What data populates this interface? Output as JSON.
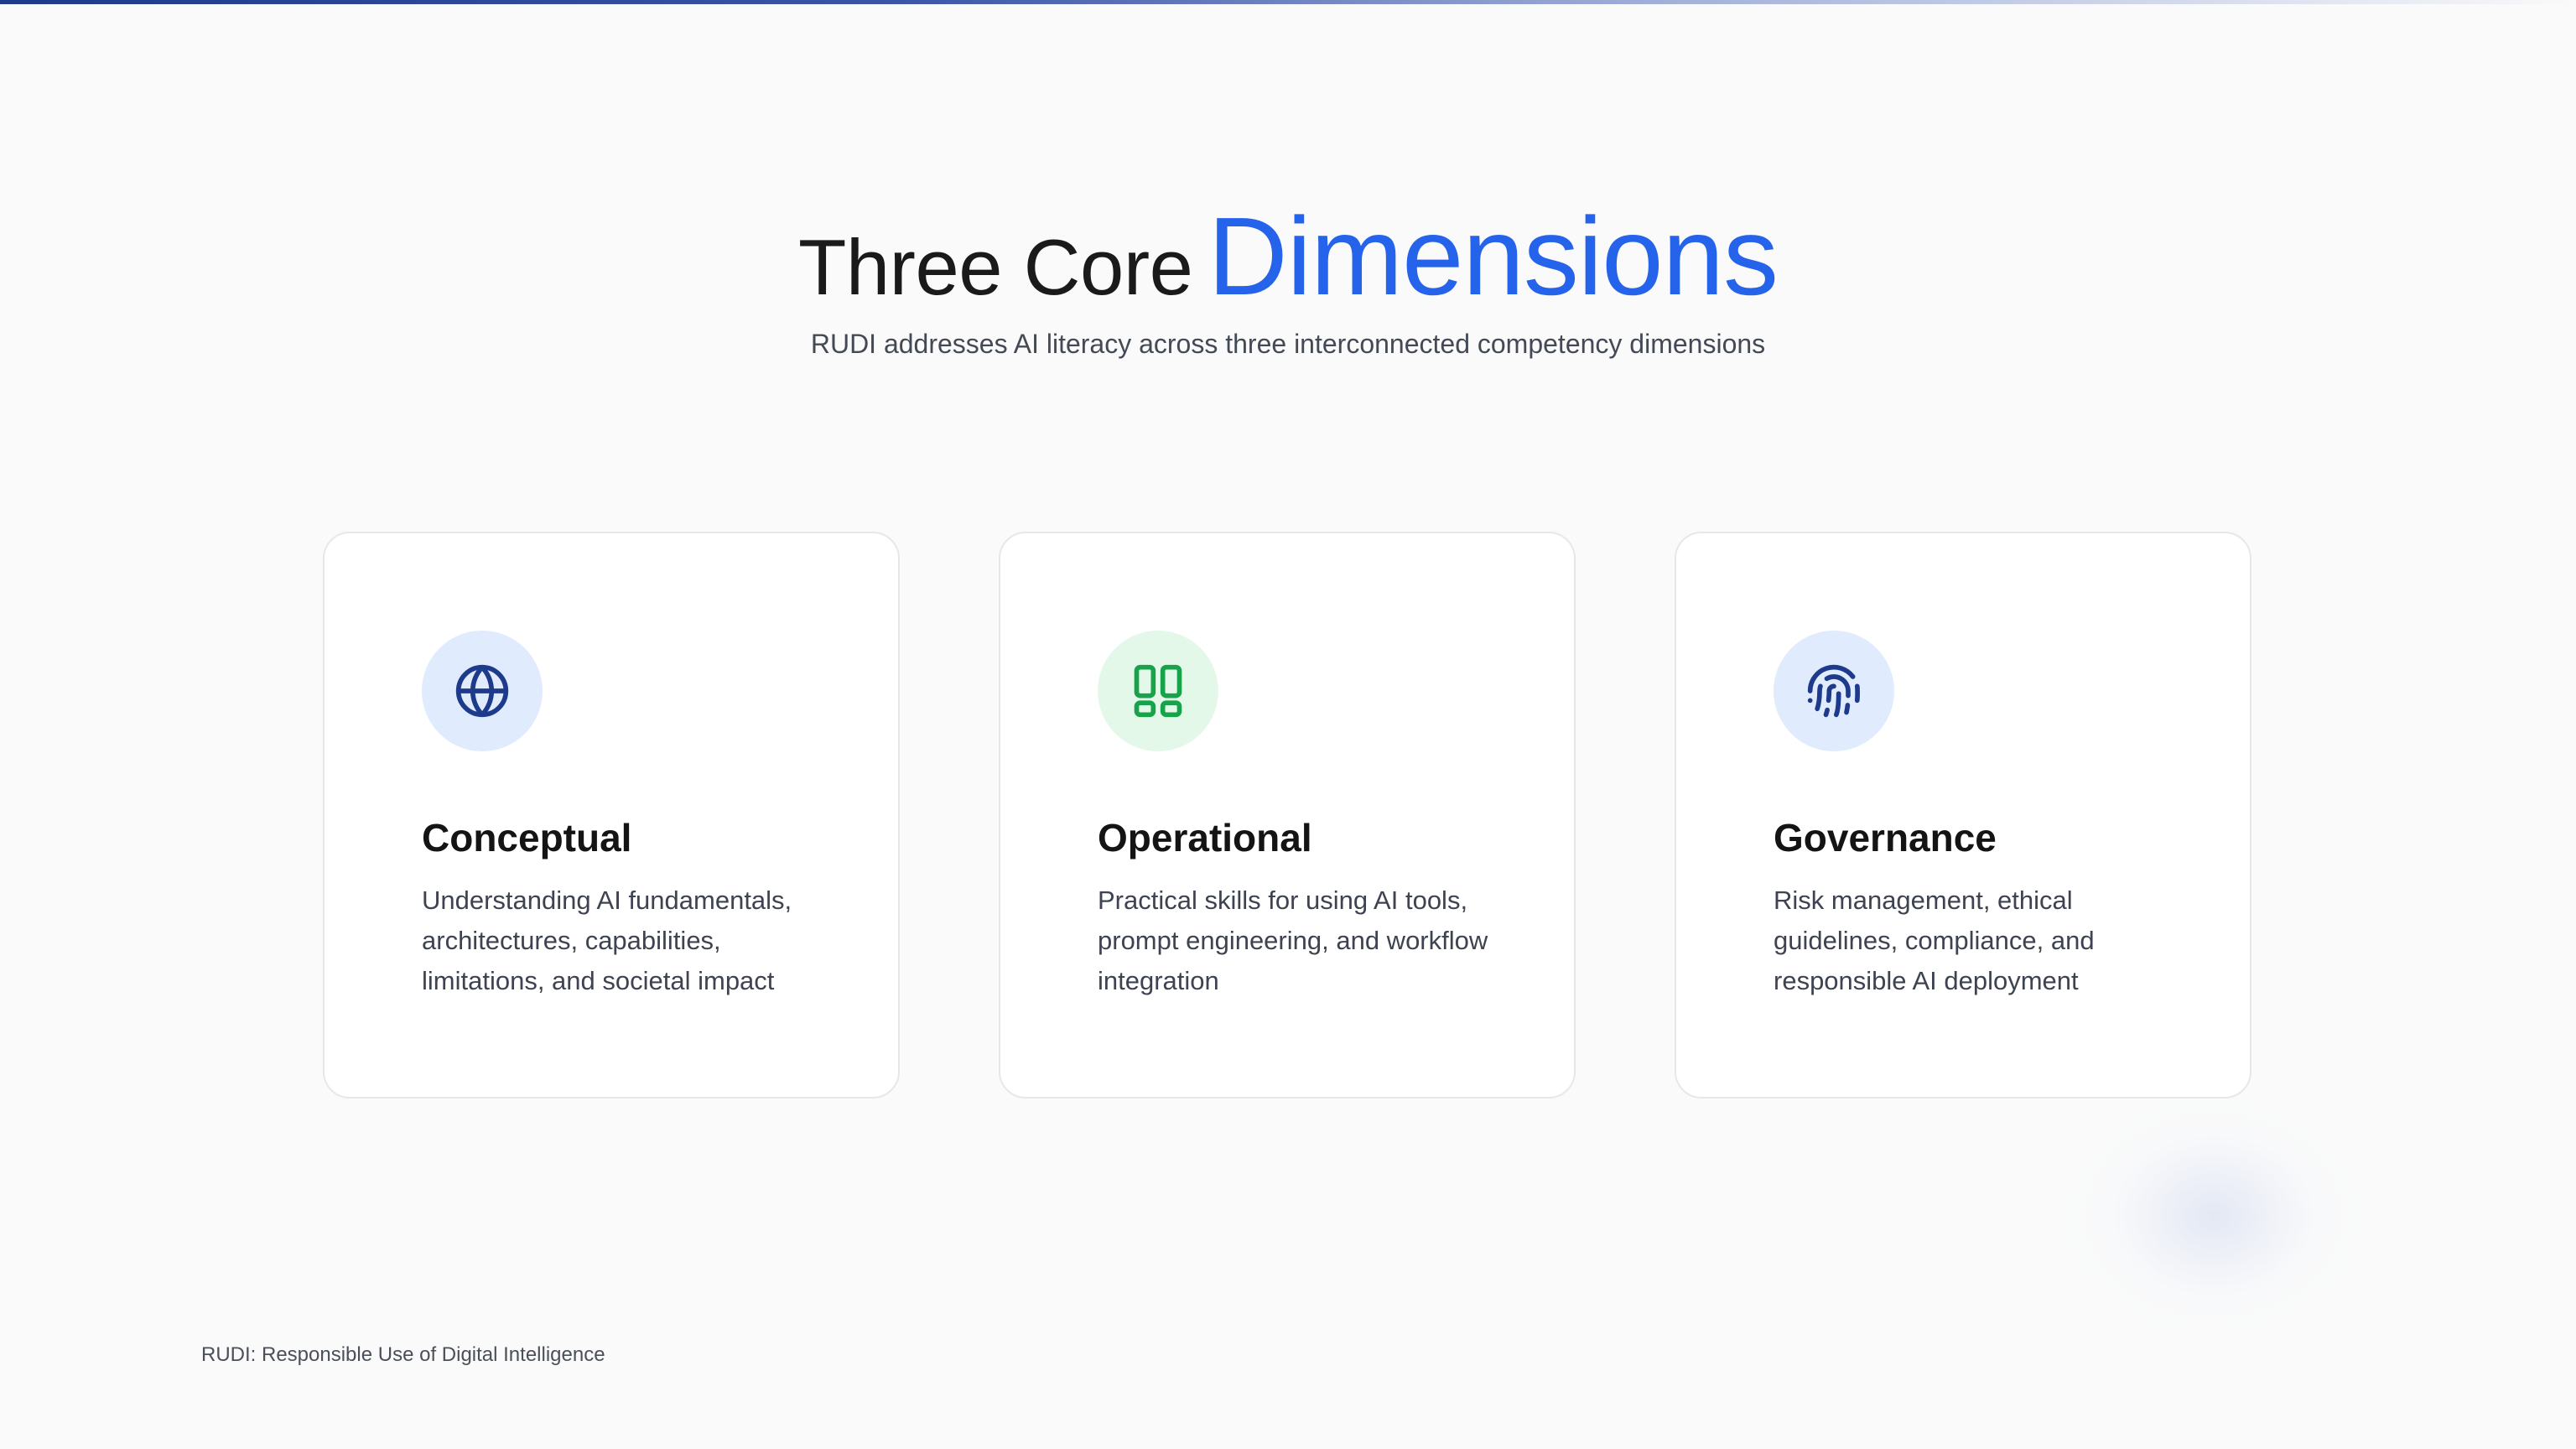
{
  "heading": {
    "title_lead": "Three Core",
    "title_accent": "Dimensions",
    "subtitle": "RUDI addresses AI literacy across three interconnected competency dimensions"
  },
  "cards": [
    {
      "icon": "globe-icon",
      "title": "Conceptual",
      "description": "Understanding AI fundamentals, architectures, capabilities, limitations, and societal impact"
    },
    {
      "icon": "grid-icon",
      "title": "Operational",
      "description": "Practical skills for using AI tools, prompt engineering, and workflow integration"
    },
    {
      "icon": "fingerprint-icon",
      "title": "Governance",
      "description": "Risk management, ethical guidelines, compliance, and responsible AI deployment"
    }
  ],
  "footer": {
    "text": "RUDI: Responsible Use of Digital Intelligence"
  },
  "colors": {
    "accent": "#2563eb",
    "icon_blue": "#1e3a8a",
    "icon_green": "#16a34a",
    "card_border": "#e6e7ea",
    "background": "#fafafa"
  }
}
